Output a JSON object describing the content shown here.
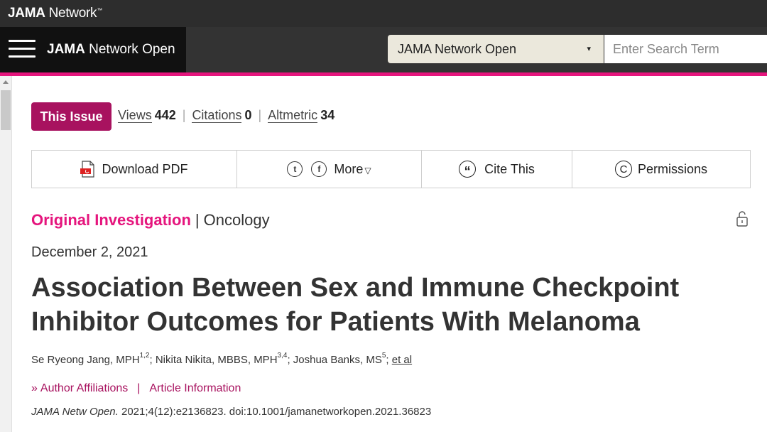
{
  "network": {
    "brand_bold": "JAMA",
    "brand_rest": "Network",
    "tm": "™"
  },
  "journal": {
    "title_bold": "JAMA",
    "title_rest": "Network Open",
    "select_value": "JAMA Network Open",
    "select_arrow": "▾",
    "search_placeholder": "Enter Search Term"
  },
  "metrics": {
    "this_issue": "This Issue",
    "views_label": "Views",
    "views_value": "442",
    "citations_label": "Citations",
    "citations_value": "0",
    "altmetric_label": "Altmetric",
    "altmetric_value": "34",
    "separator": "|"
  },
  "toolbar": {
    "download_pdf": "Download PDF",
    "twitter_glyph": "t",
    "facebook_glyph": "f",
    "more": "More",
    "more_arrow": "▽",
    "cite_this": "Cite This",
    "cite_glyph": "“",
    "permissions": "Permissions",
    "permissions_glyph": "C"
  },
  "article": {
    "category": "Original Investigation",
    "pipe": "|",
    "subject": "Oncology",
    "date": "December 2, 2021",
    "title": "Association Between Sex and Immune Checkpoint Inhibitor Outcomes for Patients With Melanoma",
    "authors": [
      {
        "name": "Se Ryeong Jang, MPH",
        "sup": "1,2",
        "sep": "; "
      },
      {
        "name": "Nikita Nikita, MBBS, MPH",
        "sup": "3,4",
        "sep": "; "
      },
      {
        "name": "Joshua Banks, MS",
        "sup": "5",
        "sep": "; "
      }
    ],
    "et_al": "et al",
    "chevron": "»",
    "author_affiliations": "Author Affiliations",
    "links_separator": "|",
    "article_information": "Article Information",
    "citation_journal": "JAMA Netw Open.",
    "citation_rest": " 2021;4(12):e2136823. doi:10.1001/jamanetworkopen.2021.36823"
  },
  "colors": {
    "accent_pink": "#e5157d",
    "accent_magenta": "#a8125f",
    "header_dark": "#333333"
  }
}
